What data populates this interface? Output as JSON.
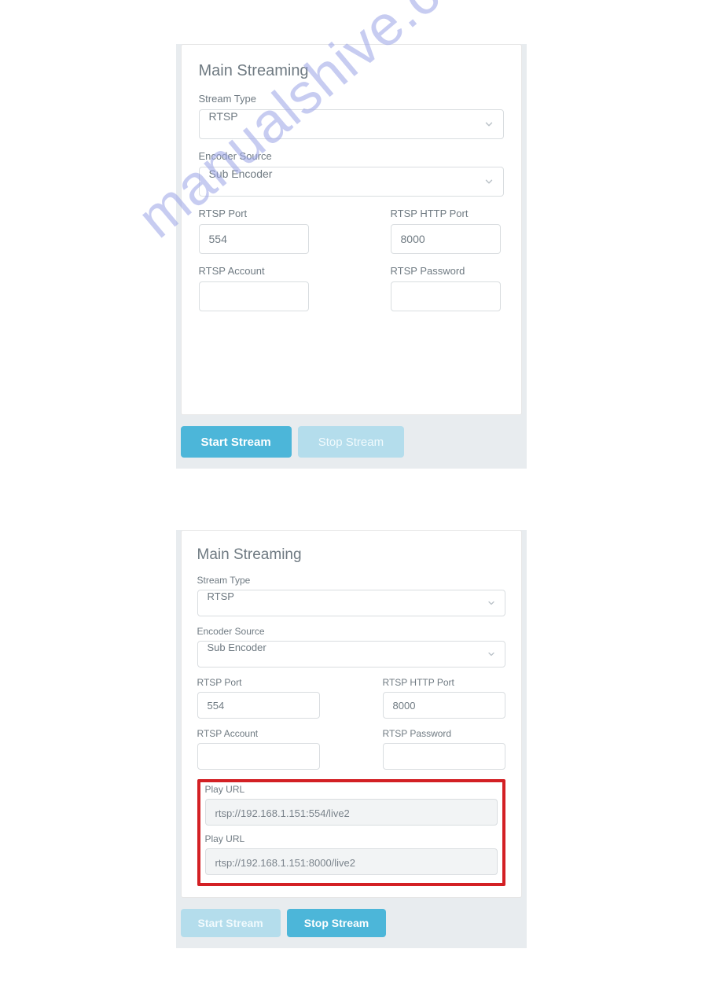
{
  "watermark": "manualshive.com",
  "panel1": {
    "title": "Main Streaming",
    "stream_type_label": "Stream Type",
    "stream_type_value": "RTSP",
    "encoder_source_label": "Encoder Source",
    "encoder_source_value": "Sub Encoder",
    "rtsp_port_label": "RTSP Port",
    "rtsp_port_value": "554",
    "rtsp_http_port_label": "RTSP HTTP Port",
    "rtsp_http_port_value": "8000",
    "rtsp_account_label": "RTSP Account",
    "rtsp_account_value": "",
    "rtsp_password_label": "RTSP Password",
    "rtsp_password_value": "",
    "start_btn": "Start Stream",
    "stop_btn": "Stop Stream"
  },
  "panel2": {
    "title": "Main Streaming",
    "stream_type_label": "Stream Type",
    "stream_type_value": "RTSP",
    "encoder_source_label": "Encoder Source",
    "encoder_source_value": "Sub Encoder",
    "rtsp_port_label": "RTSP Port",
    "rtsp_port_value": "554",
    "rtsp_http_port_label": "RTSP HTTP Port",
    "rtsp_http_port_value": "8000",
    "rtsp_account_label": "RTSP Account",
    "rtsp_account_value": "",
    "rtsp_password_label": "RTSP Password",
    "rtsp_password_value": "",
    "play_url1_label": "Play URL",
    "play_url1_value": "rtsp://192.168.1.151:554/live2",
    "play_url2_label": "Play URL",
    "play_url2_value": "rtsp://192.168.1.151:8000/live2",
    "start_btn": "Start Stream",
    "stop_btn": "Stop Stream"
  }
}
